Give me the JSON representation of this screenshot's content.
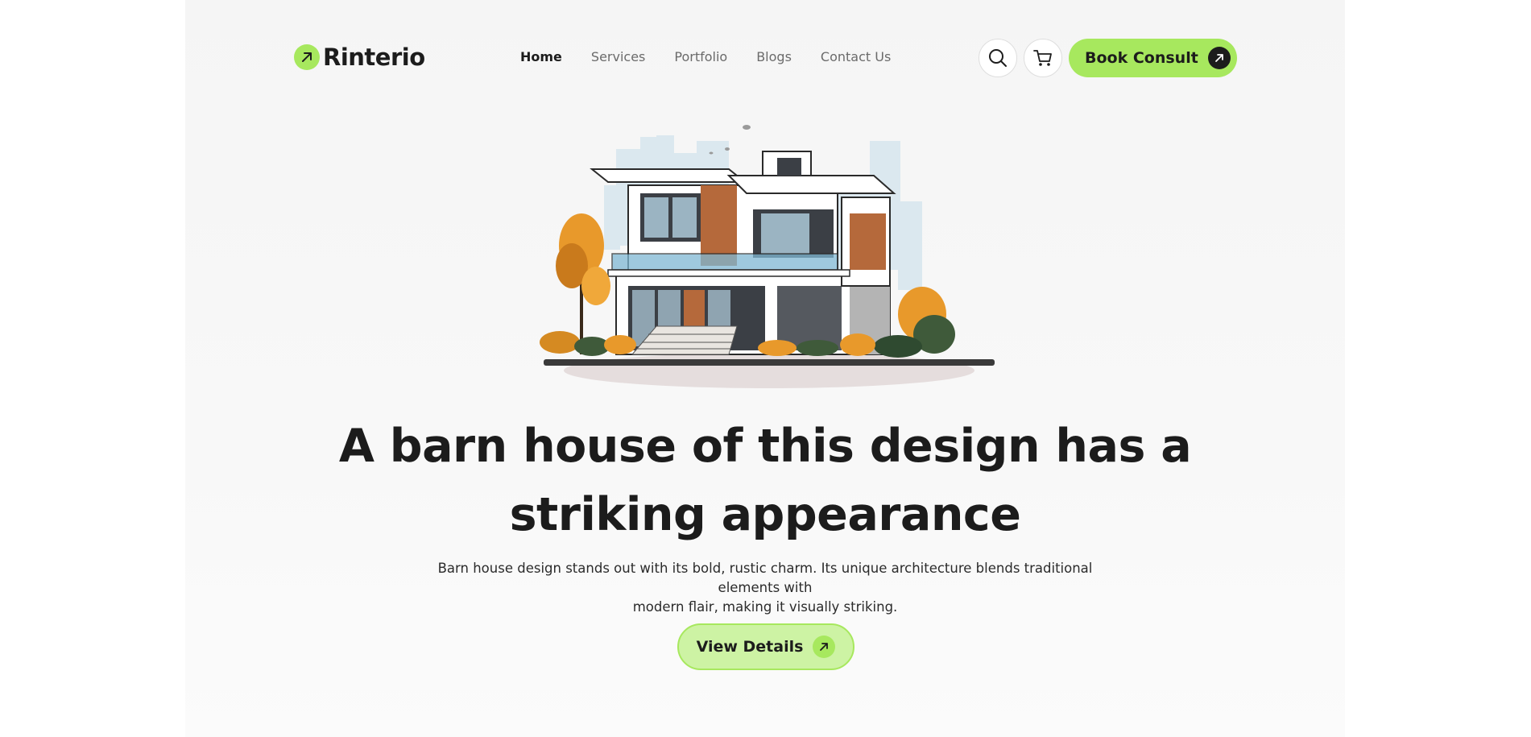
{
  "brand": {
    "name": "Rinterio",
    "accent": "#a7e85e",
    "dark": "#1c1c1c",
    "icon": "arrow-up-right-icon"
  },
  "nav": {
    "items": [
      {
        "label": "Home",
        "active": true
      },
      {
        "label": "Services",
        "active": false
      },
      {
        "label": "Portfolio",
        "active": false
      },
      {
        "label": "Blogs",
        "active": false
      },
      {
        "label": "Contact Us",
        "active": false
      }
    ]
  },
  "header": {
    "search_icon": "search-icon",
    "cart_icon": "cart-icon",
    "book_label": "Book Consult"
  },
  "hero": {
    "image": "modern-house-illustration",
    "headline_line1": "A barn house of this design has a",
    "headline_line2": "striking appearance",
    "subtext_line1": "Barn house design stands out with its bold, rustic charm. Its unique architecture blends traditional elements with",
    "subtext_line2": "modern flair, making it visually striking.",
    "cta_label": "View Details"
  }
}
